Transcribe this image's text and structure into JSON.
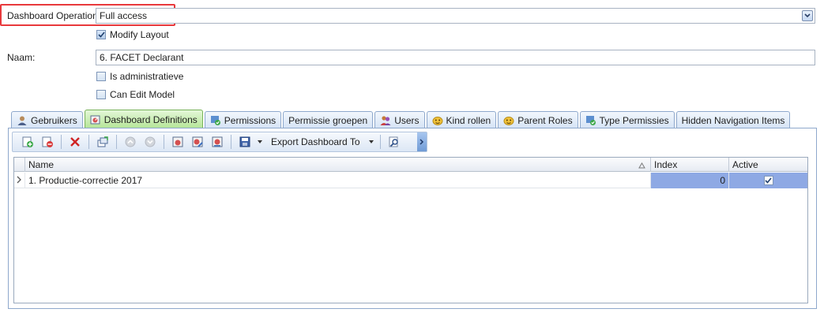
{
  "form": {
    "dashboard_operation_label": "Dashboard Operation:",
    "dashboard_operation_value": "Full access",
    "modify_layout_label": "Modify Layout",
    "modify_layout_checked": true,
    "naam_label": "Naam:",
    "naam_value": "6. FACET Declarant",
    "is_administratieve_label": "Is administratieve",
    "is_administratieve_checked": false,
    "can_edit_model_label": "Can Edit Model",
    "can_edit_model_checked": false
  },
  "tabs": [
    {
      "label": "Gebruikers",
      "icon": "user-icon",
      "active": false
    },
    {
      "label": "Dashboard Definitions",
      "icon": "dashboard-icon",
      "active": true
    },
    {
      "label": "Permissions",
      "icon": "permissions-icon",
      "active": false
    },
    {
      "label": "Permissie groepen",
      "icon": "",
      "active": false
    },
    {
      "label": "Users",
      "icon": "users-icon",
      "active": false
    },
    {
      "label": "Kind rollen",
      "icon": "mask-icon",
      "active": false
    },
    {
      "label": "Parent Roles",
      "icon": "mask-icon",
      "active": false
    },
    {
      "label": "Type Permissies",
      "icon": "permissions-icon",
      "active": false
    },
    {
      "label": "Hidden Navigation Items",
      "icon": "",
      "active": false
    }
  ],
  "toolbar": {
    "export_label": "Export Dashboard To"
  },
  "grid": {
    "columns": [
      "Name",
      "Index",
      "Active"
    ],
    "rows": [
      {
        "name": "1. Productie-correctie 2017",
        "index": "0",
        "active": true
      }
    ]
  },
  "colors": {
    "highlight_border": "#e8393c",
    "active_tab": "#b4e596",
    "selected_cell": "#8ea9e4"
  }
}
